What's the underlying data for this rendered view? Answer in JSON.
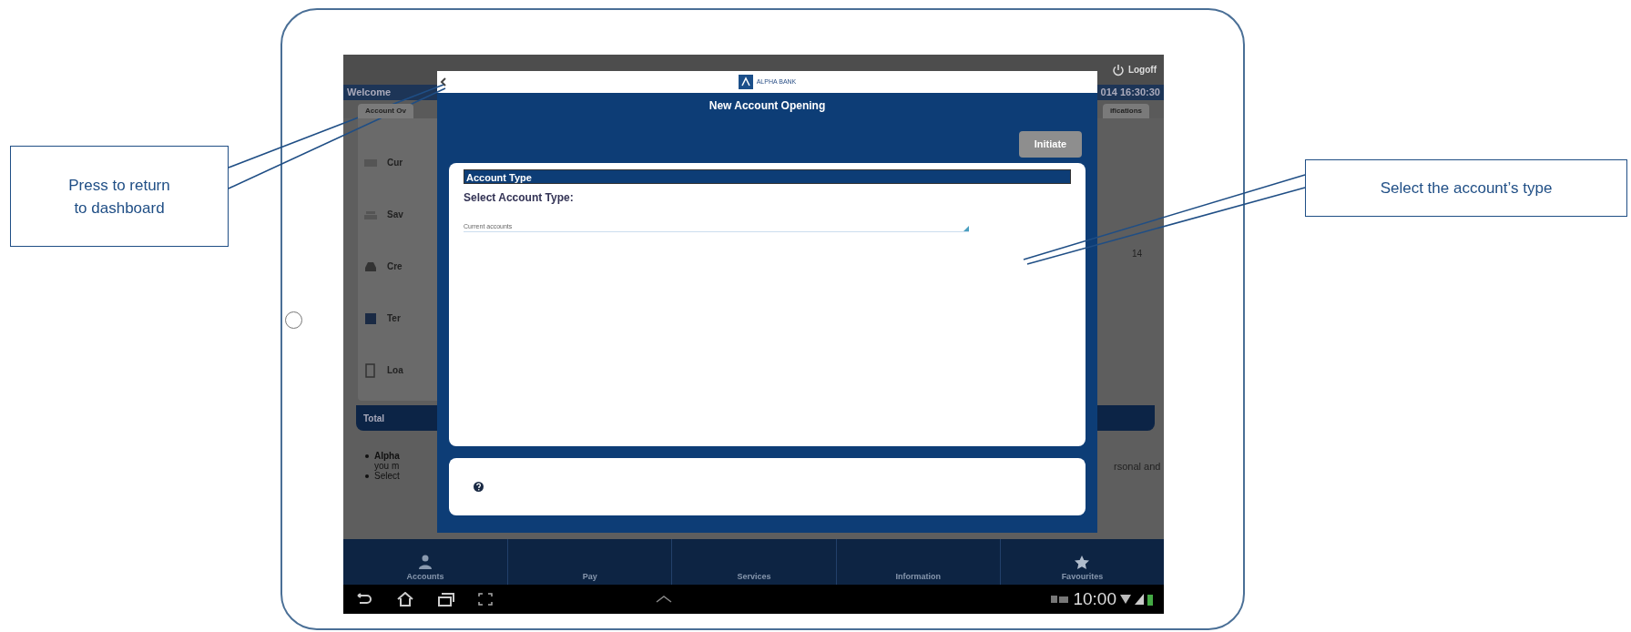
{
  "background_screen": {
    "logoff": "Logoff",
    "greeting": "Welcome",
    "datetime": "014 16:30:30",
    "tabs": [
      {
        "label": "Account Ov"
      },
      {
        "label": "ifications"
      }
    ],
    "accounts": [
      {
        "label": "Cur"
      },
      {
        "label": "Sav"
      },
      {
        "label": "Cre"
      },
      {
        "label": "Ter"
      },
      {
        "label": "Loa"
      }
    ],
    "balance_fragment": "14",
    "total_label": "Total",
    "notes": [
      {
        "lines": [
          "**Alpha**",
          "you m"
        ]
      },
      {
        "lines": [
          "Select"
        ]
      }
    ],
    "right_note": "rsonal and"
  },
  "modal": {
    "logo_text": "ALPHA BANK",
    "title": "New Account Opening",
    "button": "Initiate",
    "section_title": "Account Type",
    "field_label": "Select Account Type:",
    "select_value": "Current accounts"
  },
  "bottom_nav": [
    {
      "label": "Accounts"
    },
    {
      "label": "Pay"
    },
    {
      "label": "Services"
    },
    {
      "label": "Information"
    },
    {
      "label": "Favourites"
    }
  ],
  "status_bar": {
    "time": "10:00"
  },
  "callouts": [
    {
      "text": "Press to return to dashboard"
    },
    {
      "text": "Select the account’s type"
    }
  ]
}
